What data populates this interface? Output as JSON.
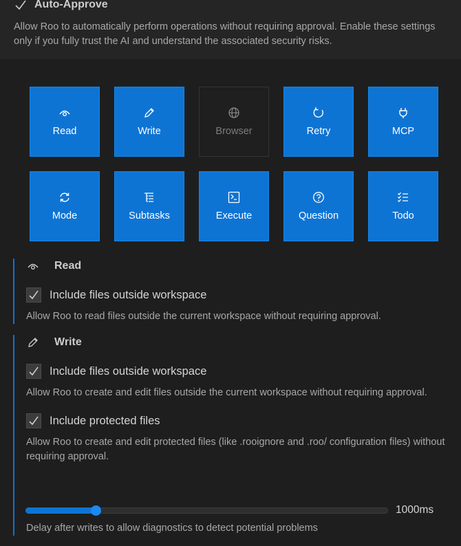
{
  "header": {
    "title": "Auto-Approve",
    "description": "Allow Roo to automatically perform operations without requiring approval. Enable these settings only if you fully trust the AI and understand the associated security risks."
  },
  "tiles": [
    {
      "label": "Read",
      "icon": "eye-icon",
      "enabled": true
    },
    {
      "label": "Write",
      "icon": "pencil-icon",
      "enabled": true
    },
    {
      "label": "Browser",
      "icon": "globe-icon",
      "enabled": false
    },
    {
      "label": "Retry",
      "icon": "refresh-icon",
      "enabled": true
    },
    {
      "label": "MCP",
      "icon": "plug-icon",
      "enabled": true
    },
    {
      "label": "Mode",
      "icon": "sync-icon",
      "enabled": true
    },
    {
      "label": "Subtasks",
      "icon": "list-tree-icon",
      "enabled": true
    },
    {
      "label": "Execute",
      "icon": "terminal-icon",
      "enabled": true
    },
    {
      "label": "Question",
      "icon": "question-icon",
      "enabled": true
    },
    {
      "label": "Todo",
      "icon": "checklist-icon",
      "enabled": true
    }
  ],
  "read_section": {
    "title": "Read",
    "outside_label": "Include files outside workspace",
    "outside_checked": true,
    "outside_help": "Allow Roo to read files outside the current workspace without requiring approval."
  },
  "write_section": {
    "title": "Write",
    "outside_label": "Include files outside workspace",
    "outside_checked": true,
    "outside_help": "Allow Roo to create and edit files outside the current workspace without requiring approval.",
    "protected_label": "Include protected files",
    "protected_checked": true,
    "protected_help": "Allow Roo to create and edit protected files (like .rooignore and .roo/ configuration files) without requiring approval.",
    "delay_value": "1000ms",
    "delay_fraction": 0.2,
    "delay_help": "Delay after writes to allow diagnostics to detect potential problems"
  },
  "colors": {
    "accent": "#0e74d4",
    "background": "#1e1e1e",
    "tile_disabled": "#1f1f1f"
  }
}
